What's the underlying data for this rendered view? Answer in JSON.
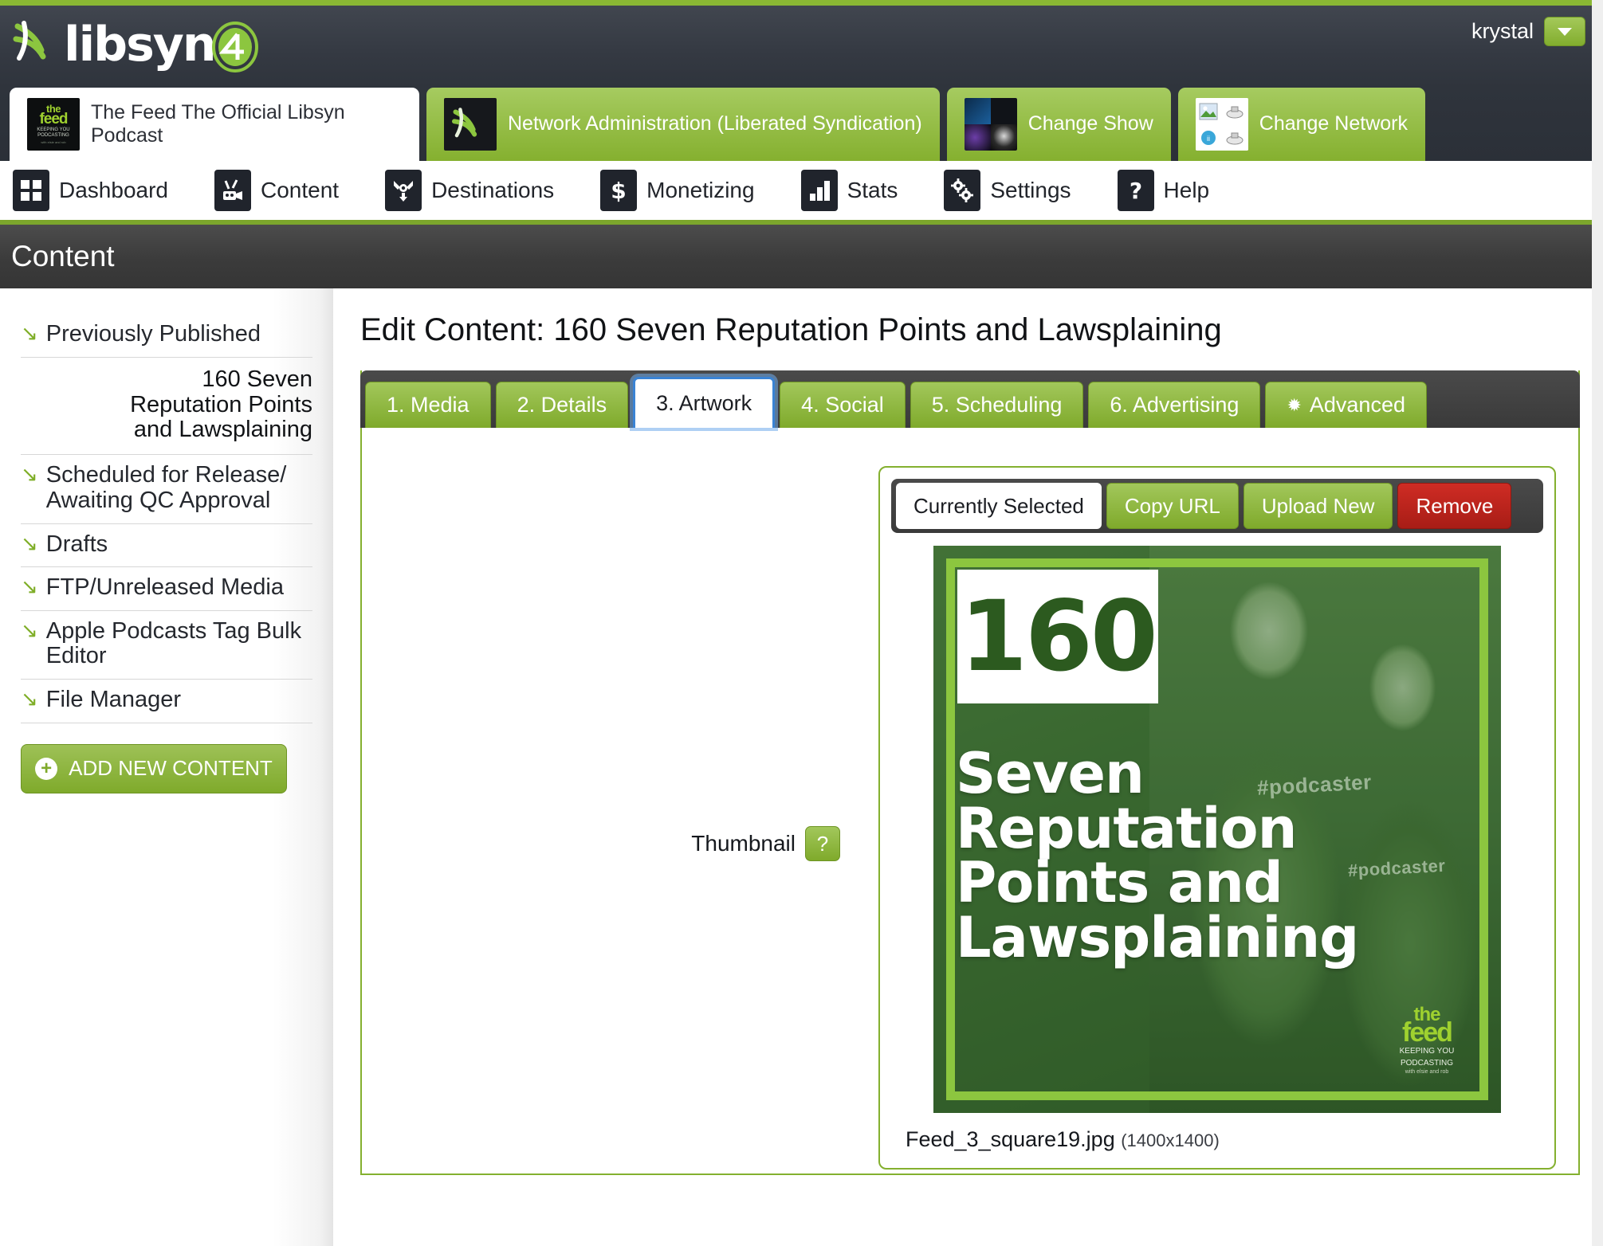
{
  "brand": {
    "logo_text": "libsyn",
    "logo_number": "4"
  },
  "user": {
    "name": "krystal",
    "caret_icon": "chevron-down-icon"
  },
  "show_tabs": [
    {
      "label": "The Feed The Official Libsyn Podcast",
      "active": true,
      "thumb": "the-feed-album-art"
    },
    {
      "label": "Network Administration (Liberated Syndication)",
      "active": false,
      "thumb": "libsyn-mark"
    },
    {
      "label": "Change Show",
      "active": false,
      "thumb": "show-grid"
    },
    {
      "label": "Change Network",
      "active": false,
      "thumb": "network-grid"
    }
  ],
  "main_nav": [
    {
      "label": "Dashboard",
      "icon": "grid-icon"
    },
    {
      "label": "Content",
      "icon": "content-camera-icon"
    },
    {
      "label": "Destinations",
      "icon": "destinations-icon"
    },
    {
      "label": "Monetizing",
      "icon": "dollar-icon"
    },
    {
      "label": "Stats",
      "icon": "bar-chart-icon"
    },
    {
      "label": "Settings",
      "icon": "gears-icon"
    },
    {
      "label": "Help",
      "icon": "question-mark-icon"
    }
  ],
  "section": {
    "title": "Content"
  },
  "sidebar": {
    "items": [
      {
        "label": "Previously Published",
        "arrow": "arrow-down-right-icon"
      },
      {
        "label": "Scheduled for Release/ Awaiting QC Approval",
        "arrow": "arrow-down-right-icon"
      },
      {
        "label": "Drafts",
        "arrow": "arrow-down-right-icon"
      },
      {
        "label": "FTP/Unreleased Media",
        "arrow": "arrow-down-right-icon"
      },
      {
        "label": "Apple Podcasts Tag Bulk Editor",
        "arrow": "arrow-down-right-icon"
      },
      {
        "label": "File Manager",
        "arrow": "arrow-down-right-icon"
      }
    ],
    "current_episode": "160 Seven Reputation Points and Lawsplaining",
    "add_button": {
      "label": "ADD NEW CONTENT",
      "icon": "plus-circle-icon"
    }
  },
  "main": {
    "page_title": "Edit Content: 160 Seven Reputation Points and Lawsplaining",
    "tabs": [
      {
        "label": "1. Media",
        "active": false
      },
      {
        "label": "2. Details",
        "active": false
      },
      {
        "label": "3. Artwork",
        "active": true
      },
      {
        "label": "4. Social",
        "active": false
      },
      {
        "label": "5. Scheduling",
        "active": false
      },
      {
        "label": "6. Advertising",
        "active": false
      },
      {
        "label": "Advanced",
        "active": false,
        "icon": "gear-icon"
      }
    ],
    "artwork": {
      "field_label": "Thumbnail",
      "help_icon_label": "?",
      "toolbar": [
        {
          "label": "Currently Selected",
          "style": "white"
        },
        {
          "label": "Copy URL",
          "style": "green"
        },
        {
          "label": "Upload New",
          "style": "green"
        },
        {
          "label": "Remove",
          "style": "red"
        }
      ],
      "filename": "Feed_3_square19.jpg",
      "dimensions": "(1400x1400)",
      "image": {
        "episode_number": "160",
        "title_line1": "Seven",
        "title_line2": "Reputation",
        "title_line3": "Points and",
        "title_line4": "Lawsplaining",
        "shirt_text_1": "#podcaster",
        "shirt_text_2": "#podcaster",
        "logo_the": "the",
        "logo_feed": "feed",
        "logo_tagline_1": "KEEPING YOU",
        "logo_tagline_2": "PODCASTING",
        "logo_byline": "with elsie and rob",
        "accent_color": "#8cc63f",
        "duotone_color": "#3e6b34"
      }
    }
  },
  "colors": {
    "brand_green": "#7faa2b",
    "accent_green": "#8ab833",
    "dark_chrome": "#2f343c",
    "header_gray": "#3b3b3b",
    "danger_red": "#cf2c24",
    "focus_blue": "#3a83d4"
  }
}
